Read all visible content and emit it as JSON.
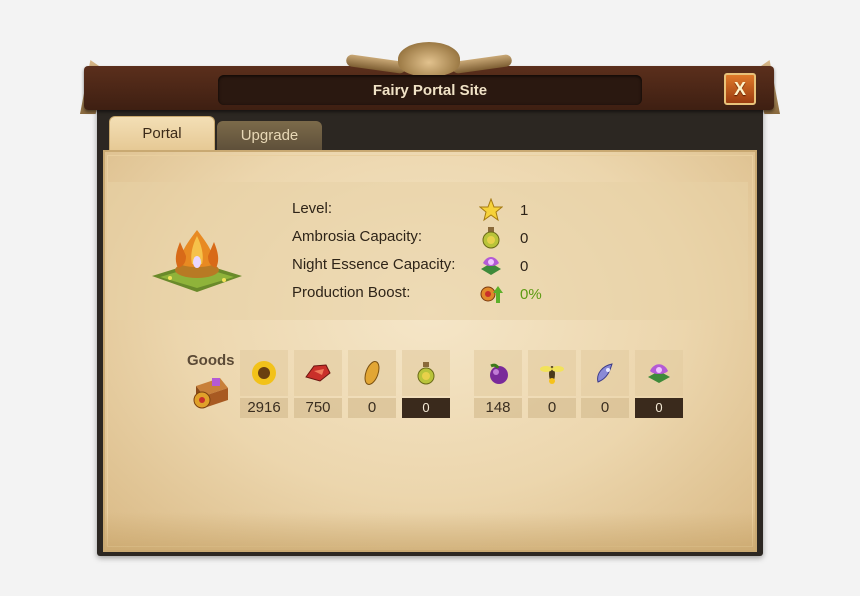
{
  "window": {
    "title": "Fairy Portal Site",
    "close_label": "X"
  },
  "tabs": [
    {
      "label": "Portal",
      "active": true
    },
    {
      "label": "Upgrade",
      "active": false
    }
  ],
  "stats": [
    {
      "label": "Level:",
      "icon": "star-icon",
      "value": "1"
    },
    {
      "label": "Ambrosia Capacity:",
      "icon": "ambrosia-icon",
      "value": "0"
    },
    {
      "label": "Night Essence Capacity:",
      "icon": "night-essence-icon",
      "value": "0"
    },
    {
      "label": "Production Boost:",
      "icon": "production-boost-icon",
      "value": "0%"
    }
  ],
  "goods": {
    "label": "Goods",
    "items": [
      {
        "icon": "sunflower-icon",
        "count": "2916"
      },
      {
        "icon": "ruby-icon",
        "count": "750"
      },
      {
        "icon": "cocoon-icon",
        "count": "0"
      },
      {
        "icon": "ambrosia-icon",
        "count": "0"
      },
      {
        "icon": "plum-icon",
        "count": "148"
      },
      {
        "icon": "firefly-icon",
        "count": "0"
      },
      {
        "icon": "fairy-dust-icon",
        "count": "0"
      },
      {
        "icon": "night-essence-icon",
        "count": "0"
      }
    ]
  },
  "colors": {
    "accent_green": "#5c9a12",
    "parchment": "#ecd6ad",
    "title_bar": "#4a2616"
  }
}
